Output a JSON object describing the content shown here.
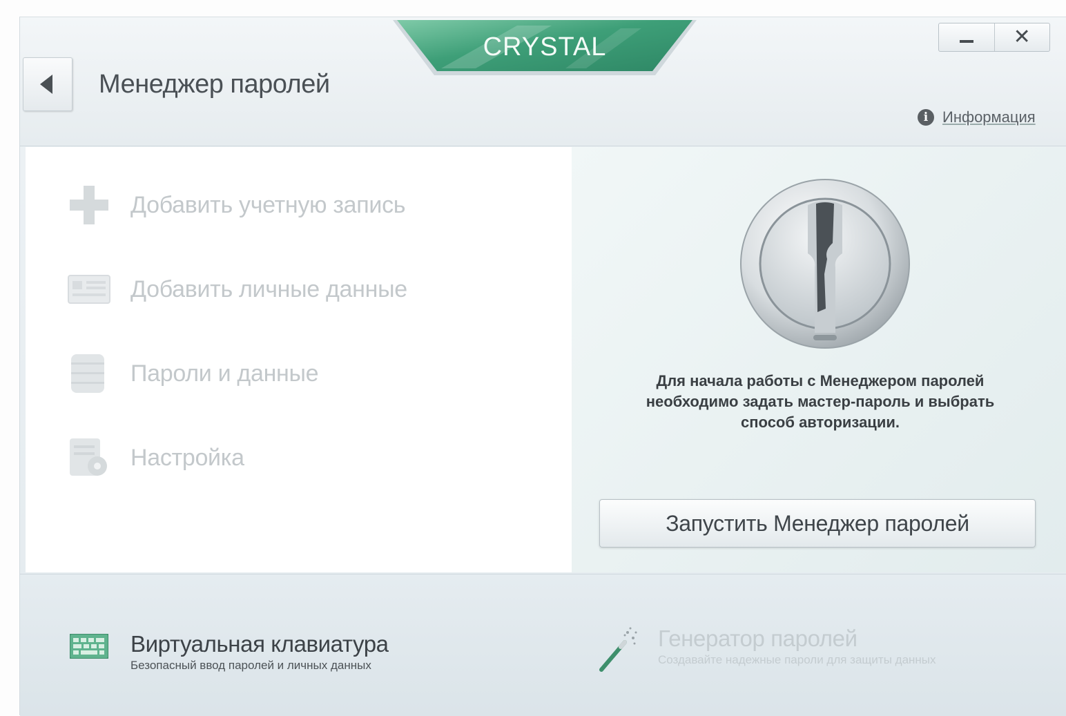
{
  "header": {
    "back_label": "",
    "title": "Менеджер паролей",
    "brand": "CRYSTAL",
    "minimize_icon": "minimize-icon",
    "close_symbol": "✕",
    "info_icon_glyph": "i",
    "info_label": "Информация"
  },
  "menu": {
    "items": [
      {
        "label": "Добавить учетную запись",
        "icon": "plus-icon"
      },
      {
        "label": "Добавить личные данные",
        "icon": "id-card-icon"
      },
      {
        "label": "Пароли и данные",
        "icon": "database-icon"
      },
      {
        "label": "Настройка",
        "icon": "settings-icon"
      }
    ]
  },
  "panel": {
    "icon": "keyhole-lock-icon",
    "message_lines": [
      "Для начала работы с Менеджером паролей",
      "необходимо задать мастер-пароль и выбрать",
      "способ авторизации."
    ],
    "start_button": "Запустить Менеджер паролей"
  },
  "footer": {
    "keyboard": {
      "title": "Виртуальная клавиатура",
      "subtitle": "Безопасный ввод паролей и личных данных",
      "icon": "keyboard-icon"
    },
    "generator": {
      "title": "Генератор паролей",
      "subtitle": "Создавайте надежные пароли для защиты данных",
      "icon": "magic-wand-icon"
    }
  },
  "colors": {
    "brand_green": "#3fa37c",
    "keyboard_green": "#4fae84",
    "disabled_text": "#c3c8cb"
  }
}
